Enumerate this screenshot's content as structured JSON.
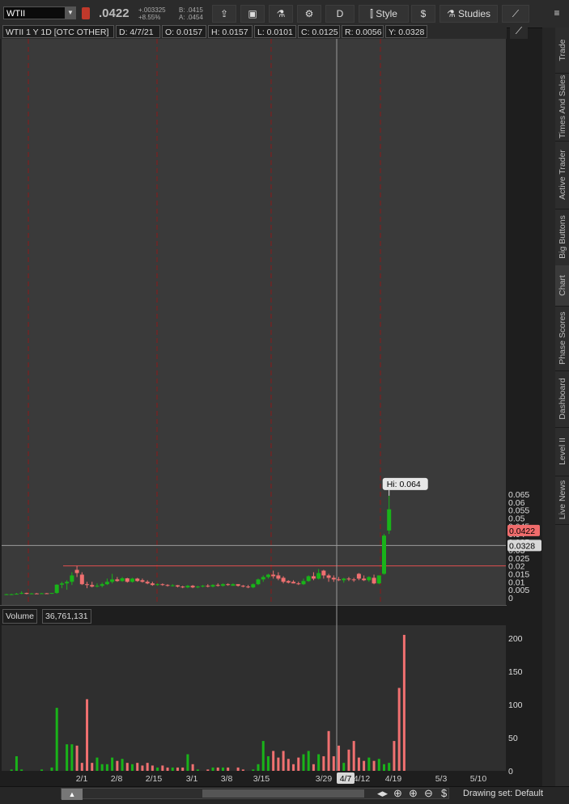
{
  "toolbar": {
    "symbol": "WTII",
    "last": ".0422",
    "change": "+.003325",
    "change_pct": "+8.55%",
    "bid": "B: .0415",
    "ask": "A: .0454",
    "timeframe": "D",
    "style_label": "Style",
    "studies_label": "Studies"
  },
  "info": {
    "title": "WTII 1 Y 1D [OTC OTHER]",
    "date": "D: 4/7/21",
    "open": "O: 0.0157",
    "high": "H: 0.0157",
    "low": "L: 0.0101",
    "close": "C: 0.0125",
    "range": "R: 0.0056",
    "cursor_y": "Y: 0.0328"
  },
  "side_tabs": [
    "Trade",
    "Times And Sales",
    "Active Trader",
    "Big Buttons",
    "Chart",
    "Phase Scores",
    "Dashboard",
    "Level II",
    "Live News"
  ],
  "volume_panel": {
    "label": "Volume",
    "value": "36,761,131",
    "unit": "<millions>"
  },
  "bottom": {
    "drawing_set": "Drawing set: Default"
  },
  "colors": {
    "up": "#19b319",
    "down": "#f07070",
    "background": "#1e1e1e",
    "grid_red": "#8b1a1a",
    "hline": "#e05050"
  },
  "chart_data": [
    {
      "type": "candlestick",
      "title": "WTII 1 Y 1D [OTC OTHER]",
      "ylim": [
        0,
        0.069
      ],
      "y_ticks": [
        0,
        0.005,
        0.01,
        0.015,
        0.02,
        0.025,
        0.03,
        0.035,
        0.04,
        0.045,
        0.05,
        0.055,
        0.06,
        0.065
      ],
      "y_tick_labels": [
        "0",
        "0.005",
        "0.01",
        "0.015",
        "0.02",
        "0.025",
        "0.03",
        "0.035",
        "0.04",
        "0.045",
        "0.05",
        "0.055",
        "0.06",
        "0.065"
      ],
      "x_labels": [
        "2/1",
        "2/8",
        "2/15",
        "3/1",
        "3/8",
        "3/15",
        "3/29",
        "4/7",
        "4/12",
        "4/19",
        "5/3",
        "5/10"
      ],
      "price_bubble": "0.0422",
      "cursor_bubble": "0.0328",
      "cursor_y": 0.0328,
      "hi_label": "Hi: 0.064",
      "hline": 0.02,
      "candles": [
        {
          "o": 0.0022,
          "h": 0.0025,
          "l": 0.002,
          "c": 0.0022
        },
        {
          "o": 0.0022,
          "h": 0.0025,
          "l": 0.002,
          "c": 0.0022
        },
        {
          "o": 0.0022,
          "h": 0.003,
          "l": 0.002,
          "c": 0.0025
        },
        {
          "o": 0.0025,
          "h": 0.004,
          "l": 0.0022,
          "c": 0.003
        },
        {
          "o": 0.003,
          "h": 0.0032,
          "l": 0.0022,
          "c": 0.0024
        },
        {
          "o": 0.0024,
          "h": 0.003,
          "l": 0.0022,
          "c": 0.0027
        },
        {
          "o": 0.0027,
          "h": 0.003,
          "l": 0.0023,
          "c": 0.0025
        },
        {
          "o": 0.0025,
          "h": 0.003,
          "l": 0.0023,
          "c": 0.0028
        },
        {
          "o": 0.0028,
          "h": 0.003,
          "l": 0.0023,
          "c": 0.0026
        },
        {
          "o": 0.0026,
          "h": 0.003,
          "l": 0.0024,
          "c": 0.003
        },
        {
          "o": 0.003,
          "h": 0.0085,
          "l": 0.0025,
          "c": 0.0082
        },
        {
          "o": 0.0082,
          "h": 0.01,
          "l": 0.006,
          "c": 0.009
        },
        {
          "o": 0.009,
          "h": 0.011,
          "l": 0.005,
          "c": 0.01
        },
        {
          "o": 0.01,
          "h": 0.016,
          "l": 0.008,
          "c": 0.014
        },
        {
          "o": 0.0175,
          "h": 0.02,
          "l": 0.013,
          "c": 0.0155
        },
        {
          "o": 0.0145,
          "h": 0.016,
          "l": 0.008,
          "c": 0.0085
        },
        {
          "o": 0.0085,
          "h": 0.01,
          "l": 0.006,
          "c": 0.008
        },
        {
          "o": 0.008,
          "h": 0.01,
          "l": 0.0065,
          "c": 0.007
        },
        {
          "o": 0.007,
          "h": 0.009,
          "l": 0.0065,
          "c": 0.0075
        },
        {
          "o": 0.0075,
          "h": 0.0095,
          "l": 0.0065,
          "c": 0.0085
        },
        {
          "o": 0.0085,
          "h": 0.012,
          "l": 0.008,
          "c": 0.01
        },
        {
          "o": 0.01,
          "h": 0.015,
          "l": 0.009,
          "c": 0.0115
        },
        {
          "o": 0.0115,
          "h": 0.013,
          "l": 0.01,
          "c": 0.0105
        },
        {
          "o": 0.0105,
          "h": 0.013,
          "l": 0.01,
          "c": 0.0122
        },
        {
          "o": 0.0122,
          "h": 0.0125,
          "l": 0.0095,
          "c": 0.01
        },
        {
          "o": 0.01,
          "h": 0.0125,
          "l": 0.0095,
          "c": 0.012
        },
        {
          "o": 0.012,
          "h": 0.0125,
          "l": 0.01,
          "c": 0.0105
        },
        {
          "o": 0.011,
          "h": 0.012,
          "l": 0.0095,
          "c": 0.01
        },
        {
          "o": 0.01,
          "h": 0.011,
          "l": 0.0085,
          "c": 0.009
        },
        {
          "o": 0.009,
          "h": 0.01,
          "l": 0.0075,
          "c": 0.008
        },
        {
          "o": 0.008,
          "h": 0.009,
          "l": 0.0075,
          "c": 0.0085
        },
        {
          "o": 0.0085,
          "h": 0.009,
          "l": 0.0075,
          "c": 0.008
        },
        {
          "o": 0.008,
          "h": 0.0085,
          "l": 0.007,
          "c": 0.0075
        },
        {
          "o": 0.0075,
          "h": 0.0085,
          "l": 0.007,
          "c": 0.0078
        },
        {
          "o": 0.0078,
          "h": 0.008,
          "l": 0.0065,
          "c": 0.007
        },
        {
          "o": 0.007,
          "h": 0.0075,
          "l": 0.006,
          "c": 0.0065
        },
        {
          "o": 0.0065,
          "h": 0.008,
          "l": 0.006,
          "c": 0.0075
        },
        {
          "o": 0.0075,
          "h": 0.008,
          "l": 0.006,
          "c": 0.0065
        },
        {
          "o": 0.0065,
          "h": 0.0075,
          "l": 0.006,
          "c": 0.007
        },
        {
          "o": 0.007,
          "h": 0.008,
          "l": 0.0065,
          "c": 0.0075
        },
        {
          "o": 0.0075,
          "h": 0.0085,
          "l": 0.0065,
          "c": 0.007
        },
        {
          "o": 0.007,
          "h": 0.0085,
          "l": 0.0065,
          "c": 0.008
        },
        {
          "o": 0.008,
          "h": 0.009,
          "l": 0.007,
          "c": 0.0075
        },
        {
          "o": 0.0075,
          "h": 0.009,
          "l": 0.007,
          "c": 0.0085
        },
        {
          "o": 0.0085,
          "h": 0.009,
          "l": 0.0075,
          "c": 0.008
        },
        {
          "o": 0.0075,
          "h": 0.009,
          "l": 0.0075,
          "c": 0.0085
        },
        {
          "o": 0.0085,
          "h": 0.0085,
          "l": 0.007,
          "c": 0.0075
        },
        {
          "o": 0.0075,
          "h": 0.008,
          "l": 0.0065,
          "c": 0.007
        },
        {
          "o": 0.007,
          "h": 0.008,
          "l": 0.006,
          "c": 0.0065
        },
        {
          "o": 0.0065,
          "h": 0.009,
          "l": 0.006,
          "c": 0.0085
        },
        {
          "o": 0.0085,
          "h": 0.012,
          "l": 0.008,
          "c": 0.0115
        },
        {
          "o": 0.0115,
          "h": 0.014,
          "l": 0.01,
          "c": 0.013
        },
        {
          "o": 0.013,
          "h": 0.015,
          "l": 0.012,
          "c": 0.0145
        },
        {
          "o": 0.0145,
          "h": 0.017,
          "l": 0.012,
          "c": 0.0135
        },
        {
          "o": 0.014,
          "h": 0.016,
          "l": 0.011,
          "c": 0.012
        },
        {
          "o": 0.0125,
          "h": 0.0135,
          "l": 0.009,
          "c": 0.01
        },
        {
          "o": 0.0105,
          "h": 0.011,
          "l": 0.009,
          "c": 0.0095
        },
        {
          "o": 0.01,
          "h": 0.011,
          "l": 0.009,
          "c": 0.009
        },
        {
          "o": 0.009,
          "h": 0.01,
          "l": 0.008,
          "c": 0.0085
        },
        {
          "o": 0.0085,
          "h": 0.012,
          "l": 0.008,
          "c": 0.0105
        },
        {
          "o": 0.0105,
          "h": 0.014,
          "l": 0.01,
          "c": 0.0135
        },
        {
          "o": 0.0135,
          "h": 0.016,
          "l": 0.011,
          "c": 0.012
        },
        {
          "o": 0.012,
          "h": 0.018,
          "l": 0.0115,
          "c": 0.0155
        },
        {
          "o": 0.017,
          "h": 0.0175,
          "l": 0.012,
          "c": 0.014
        },
        {
          "o": 0.014,
          "h": 0.015,
          "l": 0.01,
          "c": 0.0125
        },
        {
          "o": 0.0125,
          "h": 0.014,
          "l": 0.01,
          "c": 0.0115
        },
        {
          "o": 0.0115,
          "h": 0.013,
          "l": 0.0105,
          "c": 0.011
        },
        {
          "o": 0.011,
          "h": 0.0125,
          "l": 0.0095,
          "c": 0.012
        },
        {
          "o": 0.012,
          "h": 0.013,
          "l": 0.0105,
          "c": 0.0115
        },
        {
          "o": 0.0115,
          "h": 0.0125,
          "l": 0.01,
          "c": 0.011
        },
        {
          "o": 0.015,
          "h": 0.0155,
          "l": 0.011,
          "c": 0.012
        },
        {
          "o": 0.012,
          "h": 0.014,
          "l": 0.0105,
          "c": 0.011
        },
        {
          "o": 0.011,
          "h": 0.0135,
          "l": 0.01,
          "c": 0.013
        },
        {
          "o": 0.0125,
          "h": 0.0145,
          "l": 0.0085,
          "c": 0.009
        },
        {
          "o": 0.009,
          "h": 0.014,
          "l": 0.0085,
          "c": 0.014
        },
        {
          "o": 0.015,
          "h": 0.04,
          "l": 0.0145,
          "c": 0.039
        },
        {
          "o": 0.0422,
          "h": 0.064,
          "l": 0.04,
          "c": 0.0555
        }
      ]
    },
    {
      "type": "bar",
      "title": "Volume",
      "ylabel": "<millions>",
      "ylim": [
        0,
        210
      ],
      "y_ticks": [
        0,
        50,
        100,
        150,
        200
      ],
      "y_tick_labels": [
        "0",
        "50",
        "100",
        "150",
        "200"
      ],
      "values": [
        0,
        2,
        22,
        2,
        0,
        0,
        0,
        2,
        0,
        5,
        95,
        0,
        40,
        40,
        38,
        12,
        108,
        12,
        20,
        10,
        10,
        20,
        15,
        18,
        12,
        10,
        12,
        8,
        12,
        8,
        5,
        8,
        5,
        5,
        5,
        5,
        25,
        10,
        2,
        0,
        2,
        5,
        5,
        5,
        5,
        0,
        5,
        2,
        0,
        2,
        10,
        45,
        22,
        30,
        20,
        30,
        18,
        10,
        20,
        25,
        30,
        10,
        25,
        22,
        60,
        22,
        38,
        12,
        32,
        45,
        20,
        15,
        20,
        15,
        18,
        10,
        12,
        45,
        125,
        205
      ]
    }
  ]
}
